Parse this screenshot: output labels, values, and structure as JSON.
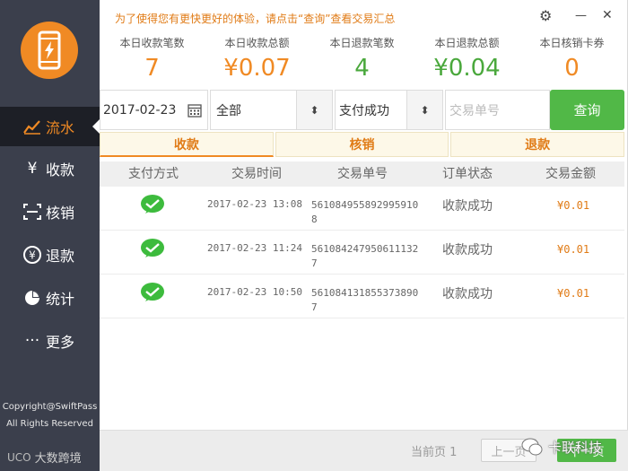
{
  "sidebar": {
    "nav": [
      {
        "label": "流水",
        "icon": "chart-line-icon",
        "glyph": "↗"
      },
      {
        "label": "收款",
        "icon": "yen-icon",
        "glyph": "¥"
      },
      {
        "label": "核销",
        "icon": "scan-icon",
        "glyph": "⌖"
      },
      {
        "label": "退款",
        "icon": "refund-icon",
        "glyph": "¥"
      },
      {
        "label": "统计",
        "icon": "pie-chart-icon",
        "glyph": "◕"
      },
      {
        "label": "更多",
        "icon": "more-icon",
        "glyph": "···"
      }
    ],
    "copyright_line1": "Copyright@SwiftPass",
    "copyright_line2": "All Rights Reserved",
    "brand": "大数跨境",
    "brand_mark": "UCO"
  },
  "header": {
    "notice": "为了使得您有更快更好的体验，请点击“查询”查看交易汇总",
    "settings_glyph": "⚙",
    "minimize_glyph": "—",
    "close_glyph": "✕"
  },
  "stats": [
    {
      "label": "本日收款笔数",
      "value": "7",
      "color": "#f08a24"
    },
    {
      "label": "本日收款总额",
      "value": "¥0.07",
      "color": "#f08a24"
    },
    {
      "label": "本日退款笔数",
      "value": "4",
      "color": "#4aa83c"
    },
    {
      "label": "本日退款总额",
      "value": "¥0.04",
      "color": "#4aa83c"
    },
    {
      "label": "本日核销卡券",
      "value": "0",
      "color": "#f08a24"
    }
  ],
  "filters": {
    "date": "2017-02-23",
    "channel": "全部",
    "status": "支付成功",
    "order_placeholder": "交易单号",
    "query_label": "查询",
    "spin_glyph": "⬍"
  },
  "tabs": [
    {
      "label": "收款",
      "active": true
    },
    {
      "label": "核销",
      "active": false
    },
    {
      "label": "退款",
      "active": false
    }
  ],
  "table": {
    "headers": [
      "支付方式",
      "交易时间",
      "交易单号",
      "订单状态",
      "交易金额"
    ],
    "rows": [
      {
        "pay": "wechat-pay-icon",
        "time": "2017-02-23 13:08",
        "order": "5610849558929959108",
        "status": "收款成功",
        "amount": "¥0.01"
      },
      {
        "pay": "wechat-pay-icon",
        "time": "2017-02-23 11:24",
        "order": "5610842479506111327",
        "status": "收款成功",
        "amount": "¥0.01"
      },
      {
        "pay": "wechat-pay-icon",
        "time": "2017-02-23 10:50",
        "order": "5610841318553738907",
        "status": "收款成功",
        "amount": "¥0.01"
      }
    ]
  },
  "pager": {
    "current": "当前页 1",
    "prev": "上一页",
    "next": "下一页"
  },
  "watermark": "卡联科技"
}
